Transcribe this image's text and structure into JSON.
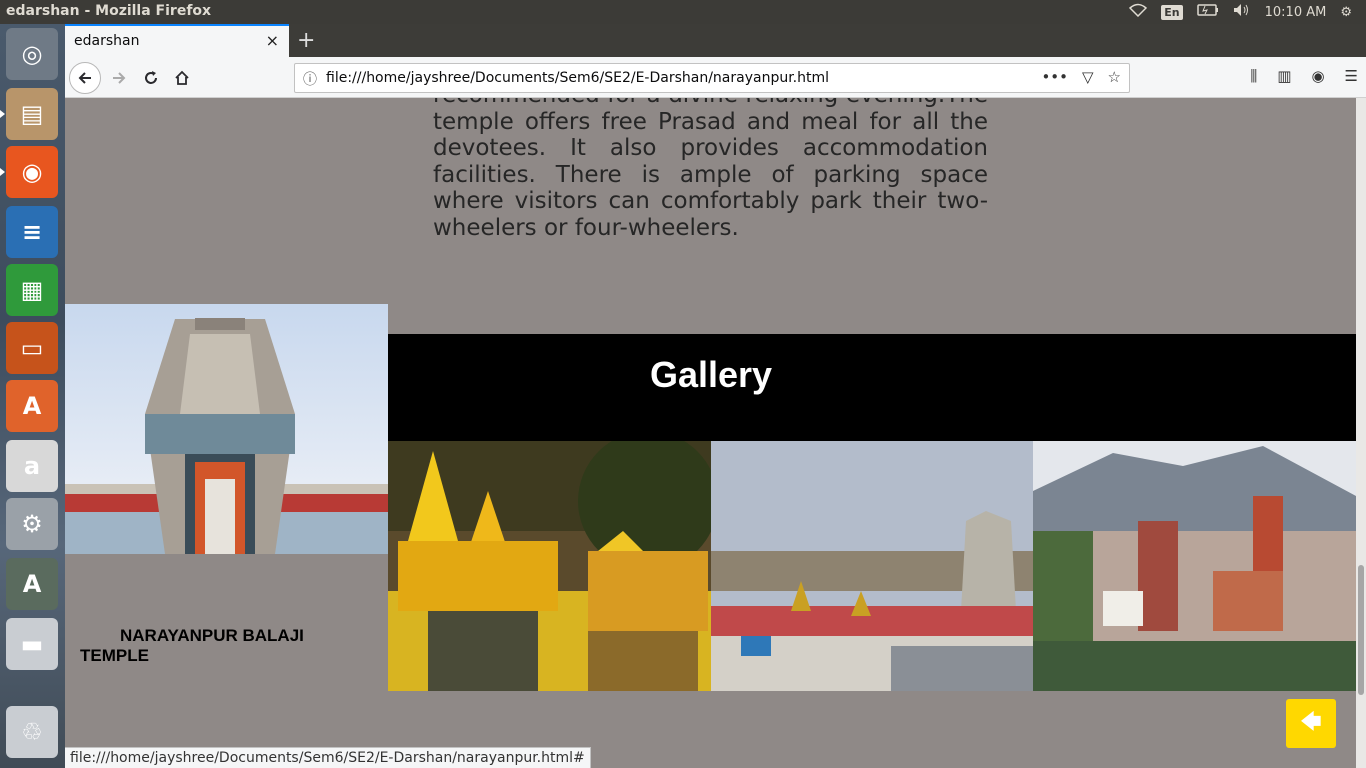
{
  "system": {
    "window_title": "edarshan - Mozilla Firefox",
    "lang": "En",
    "clock": "10:10 AM"
  },
  "launcher": {
    "items": [
      {
        "name": "ubuntu-dash-icon",
        "color": "#6f7a86",
        "glyph": "◎"
      },
      {
        "name": "files-icon",
        "color": "#b8956a",
        "glyph": "▤"
      },
      {
        "name": "firefox-icon",
        "color": "#e8561f",
        "glyph": "◉"
      },
      {
        "name": "writer-icon",
        "color": "#2a6fb4",
        "glyph": "≡"
      },
      {
        "name": "calc-icon",
        "color": "#2f9a3b",
        "glyph": "▦"
      },
      {
        "name": "impress-icon",
        "color": "#c6531b",
        "glyph": "▭"
      },
      {
        "name": "software-center-icon",
        "color": "#e0632b",
        "glyph": "A"
      },
      {
        "name": "amazon-icon",
        "color": "#d8d8d8",
        "glyph": "a"
      },
      {
        "name": "system-settings-icon",
        "color": "#9aa1a8",
        "glyph": "⚙"
      },
      {
        "name": "software-updater-icon",
        "color": "#5a6b5e",
        "glyph": "A"
      },
      {
        "name": "drive-icon",
        "color": "#c9cdd2",
        "glyph": "▬"
      },
      {
        "name": "trash-icon",
        "color": "#c9cdd2",
        "glyph": "♲"
      }
    ]
  },
  "browser": {
    "tab_title": "edarshan",
    "tab_close": "×",
    "new_tab": "+",
    "url": "file:///home/jayshree/Documents/Sem6/SE2/E-Darshan/narayanpur.html",
    "status_url": "file:///home/jayshree/Documents/Sem6/SE2/E-Darshan/narayanpur.html#"
  },
  "page": {
    "description": "recommended for a divine relaxing evening.The temple offers free Prasad and meal for all the devotees. It also provides accommodation facilities. There is ample of parking space where visitors can comfortably park their two-wheelers or four-wheelers.",
    "caption": "NARAYANPUR BALAJI TEMPLE",
    "gallery_title": "Gallery",
    "back_to_top_icon": "arrow-left"
  }
}
